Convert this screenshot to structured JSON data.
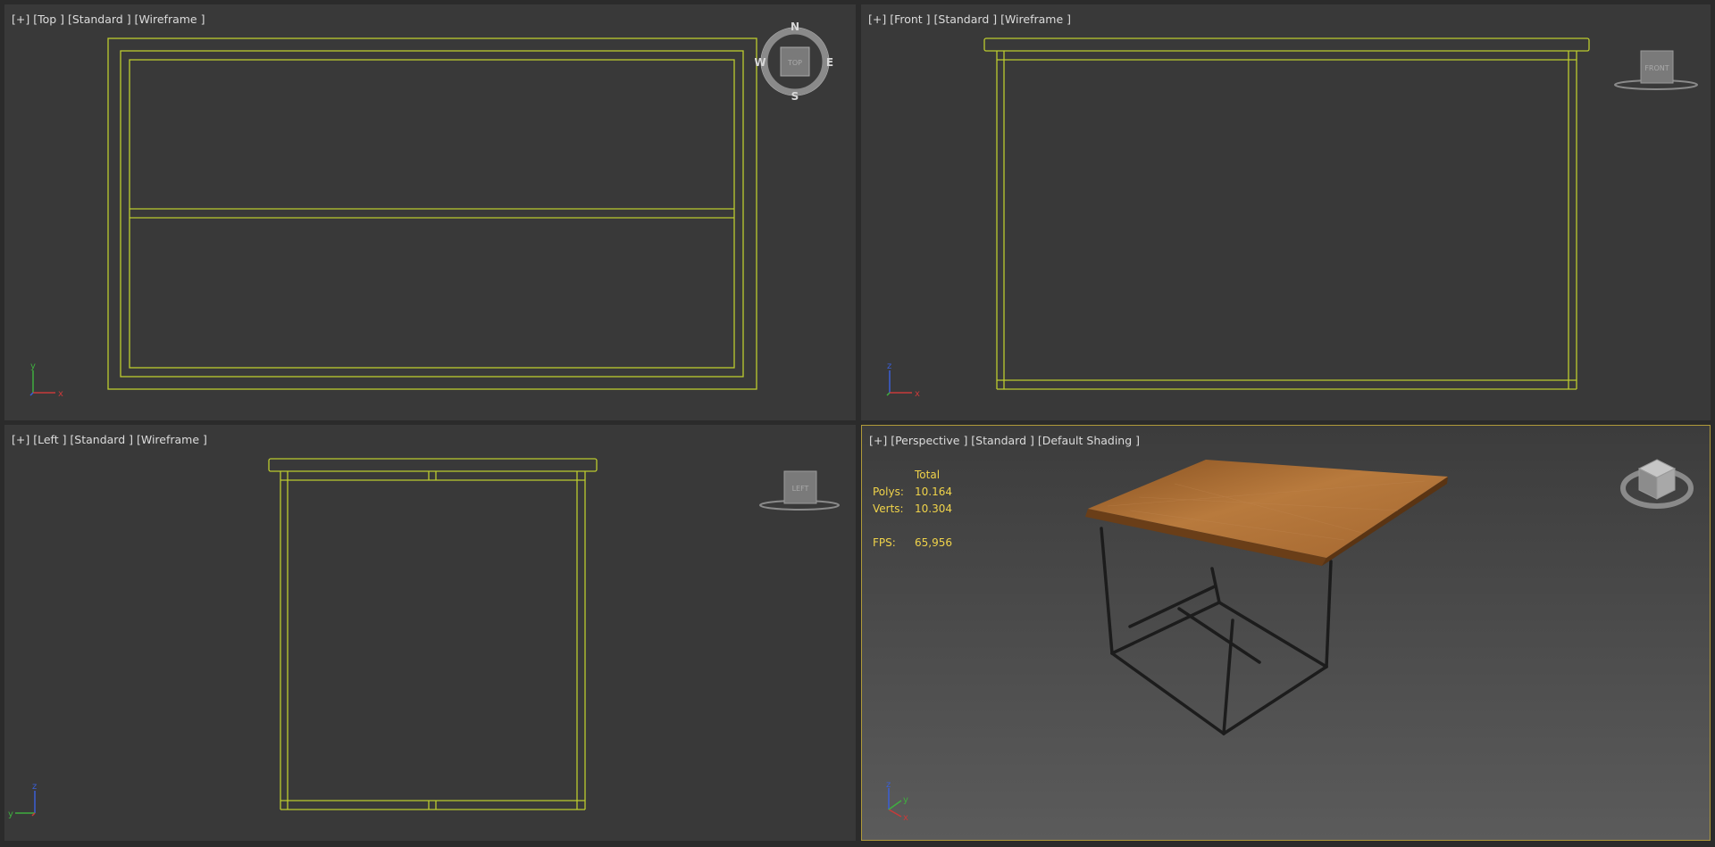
{
  "viewports": {
    "top": {
      "label": "[+] [Top ] [Standard ] [Wireframe ]"
    },
    "front": {
      "label": "[+] [Front ] [Standard ] [Wireframe ]"
    },
    "left": {
      "label": "[+] [Left ] [Standard ] [Wireframe ]"
    },
    "persp": {
      "label": "[+] [Perspective ] [Standard ] [Default Shading ]"
    }
  },
  "viewcube": {
    "top": "TOP",
    "front": "FRONT",
    "left": "LEFT",
    "compass": {
      "n": "N",
      "s": "S",
      "e": "E",
      "w": "W"
    }
  },
  "axis": {
    "x": "x",
    "y": "y",
    "z": "z"
  },
  "stats": {
    "header": "Total",
    "polys_label": "Polys:",
    "polys": "10.164",
    "verts_label": "Verts:",
    "verts": "10.304",
    "fps_label": "FPS:",
    "fps": "65,956"
  },
  "colors": {
    "wireframe": "#bccb2e",
    "active_border": "#b09a3a",
    "stats_text": "#f0d34a",
    "tabletop": "#a8672f",
    "frame": "#1e1e1e"
  }
}
